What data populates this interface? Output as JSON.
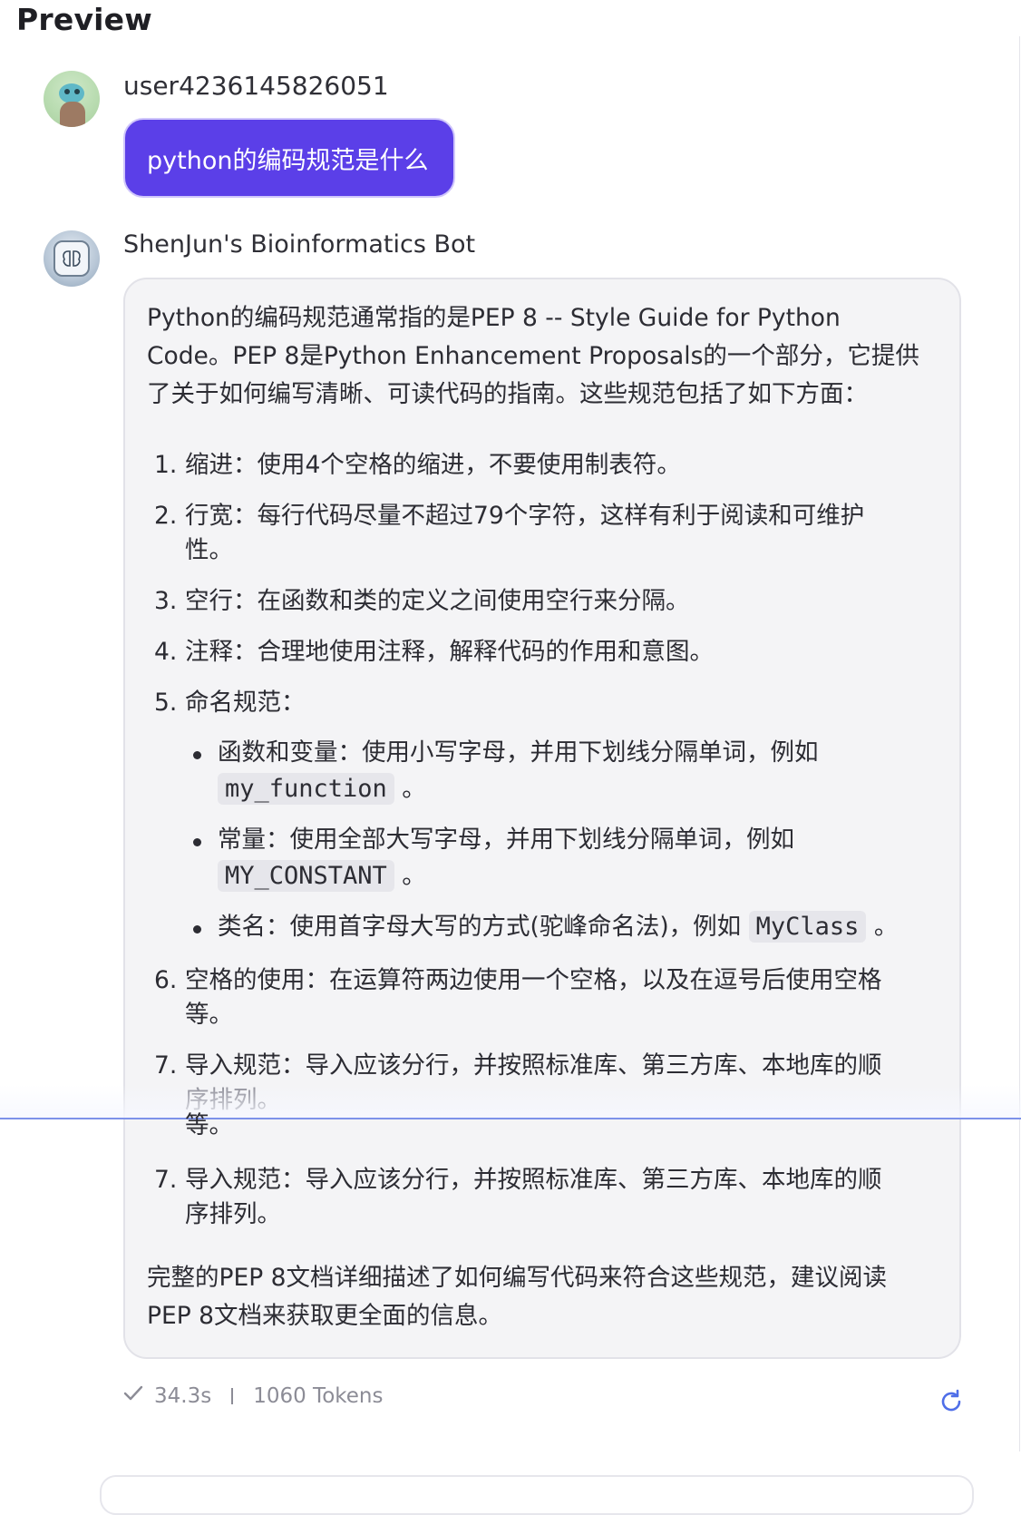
{
  "page": {
    "title": "Preview"
  },
  "user_message": {
    "username": "user4236145826051",
    "text": "python的编码规范是什么"
  },
  "bot_message": {
    "name": "ShenJun's Bioinformatics Bot",
    "intro_line1": "Python的编码规范通常指的是PEP 8 -- Style Guide for Python",
    "intro_line2": "Code。PEP 8是Python Enhancement Proposals的一个部分，它提供",
    "intro_line3": "了关于如何编写清晰、可读代码的指南。这些规范包括了如下方面：",
    "items": [
      {
        "num": "1.",
        "line1": "缩进：使用4个空格的缩进，不要使用制表符。"
      },
      {
        "num": "2.",
        "line1": "行宽：每行代码尽量不超过79个字符，这样有利于阅读和可维护",
        "line2": "性。"
      },
      {
        "num": "3.",
        "line1": "空行：在函数和类的定义之间使用空行来分隔。"
      },
      {
        "num": "4.",
        "line1": "注释：合理地使用注释，解释代码的作用和意图。"
      },
      {
        "num": "5.",
        "line1": "命名规范："
      },
      {
        "num": "6.",
        "line1": "空格的使用：在运算符两边使用一个空格，以及在逗号后使用空格",
        "line2": "等。"
      },
      {
        "num": "7.",
        "line1": "导入规范：导入应该分行，并按照标准库、第三方库、本地库的顺",
        "line2": "序排列。"
      }
    ],
    "naming": [
      {
        "prefix": "函数和变量：使用小写字母，并用下划线分隔单词，例如",
        "code": "my_function",
        "suffix": "。"
      },
      {
        "prefix": "常量：使用全部大写字母，并用下划线分隔单词，例如",
        "code": "MY_CONSTANT",
        "suffix": "。"
      },
      {
        "prefix": "类名：使用首字母大写的方式(驼峰命名法)，例如",
        "code": "MyClass",
        "suffix": "。"
      }
    ],
    "ghost_tail": "等。",
    "outro_line1": "完整的PEP 8文档详细描述了如何编写代码来符合这些规范，建议阅读",
    "outro_line2": "PEP 8文档来获取更全面的信息。"
  },
  "footer": {
    "time": "34.3s",
    "tokens": "1060 Tokens"
  },
  "icons": {
    "check": "check-icon",
    "refresh": "refresh-icon"
  },
  "colors": {
    "accent": "#5b3fe8",
    "refresh": "#4f6ee8"
  }
}
